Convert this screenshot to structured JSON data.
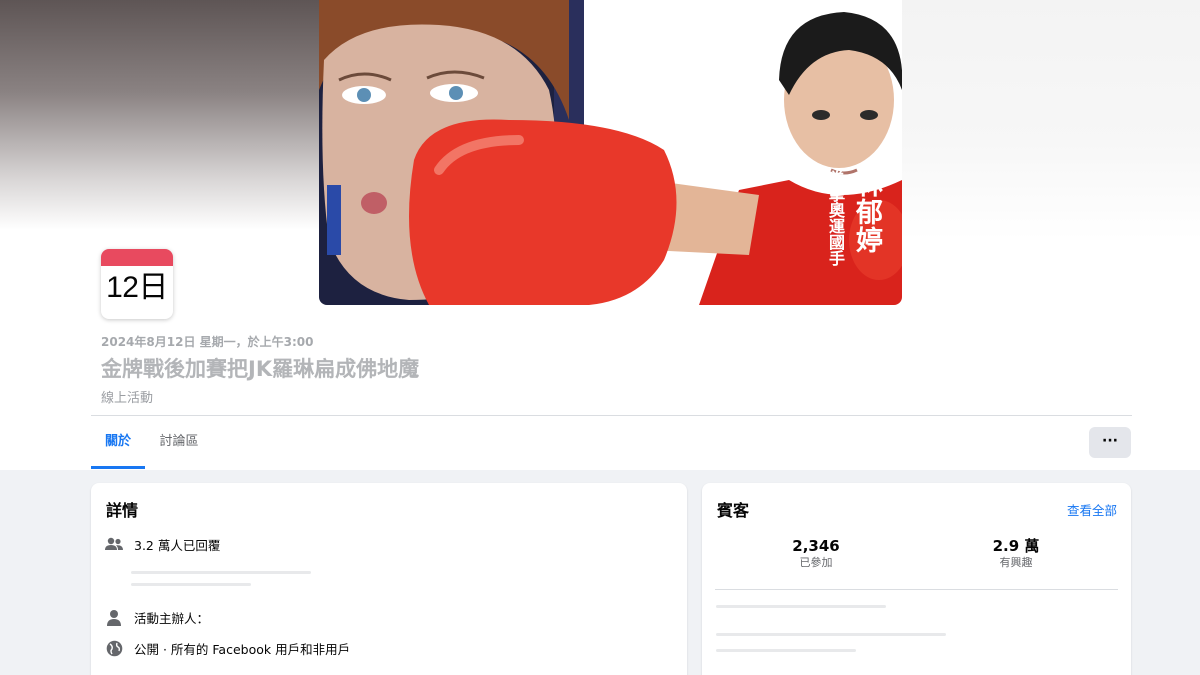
{
  "event": {
    "day_badge": "12日",
    "datetime": "2024年8月12日 星期一，於上午3:00",
    "title": "金牌戰後加賽把JK羅琳扁成佛地魔",
    "type": "線上活動"
  },
  "cover": {
    "athlete_name": "林郁婷",
    "athlete_title": "拳擊奧運國手"
  },
  "tabs": [
    {
      "label": "關於",
      "active": true
    },
    {
      "label": "討論區",
      "active": false
    }
  ],
  "more_label": "···",
  "details": {
    "title": "詳情",
    "responded": "3.2 萬人已回覆",
    "organizer": "活動主辦人：",
    "privacy": "公開 · 所有的 Facebook 用戶和非用戶"
  },
  "guests": {
    "title": "賓客",
    "see_all": "查看全部",
    "going_count": "2,346",
    "going_label": "已參加",
    "interested_count": "2.9 萬",
    "interested_label": "有興趣"
  },
  "colors": {
    "accent": "#1877f2",
    "date_badge_red": "#e84a5f",
    "glove_red": "#e8382a"
  },
  "icons": [
    "people-icon",
    "person-icon",
    "globe-icon",
    "more-icon"
  ]
}
